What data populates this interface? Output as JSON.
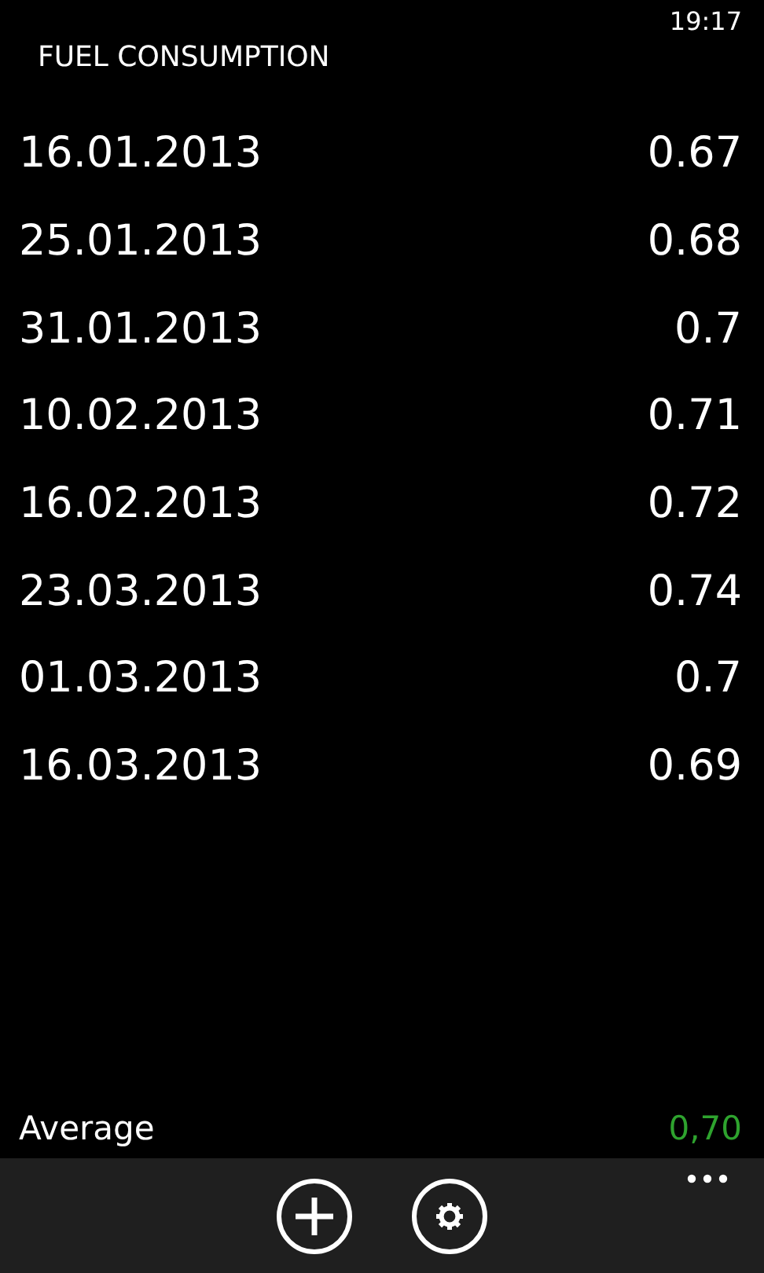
{
  "status_bar": {
    "time": "19:17"
  },
  "title": "FUEL CONSUMPTION",
  "entries": [
    {
      "date": "16.01.2013",
      "value": "0.67"
    },
    {
      "date": "25.01.2013",
      "value": "0.68"
    },
    {
      "date": "31.01.2013",
      "value": "0.7"
    },
    {
      "date": "10.02.2013",
      "value": "0.71"
    },
    {
      "date": "16.02.2013",
      "value": "0.72"
    },
    {
      "date": "23.03.2013",
      "value": "0.74"
    },
    {
      "date": "01.03.2013",
      "value": "0.7"
    },
    {
      "date": "16.03.2013",
      "value": "0.69"
    }
  ],
  "average": {
    "label": "Average",
    "value": "0,70"
  },
  "app_bar": {
    "buttons": [
      {
        "kind": "add"
      },
      {
        "kind": "settings"
      }
    ]
  }
}
